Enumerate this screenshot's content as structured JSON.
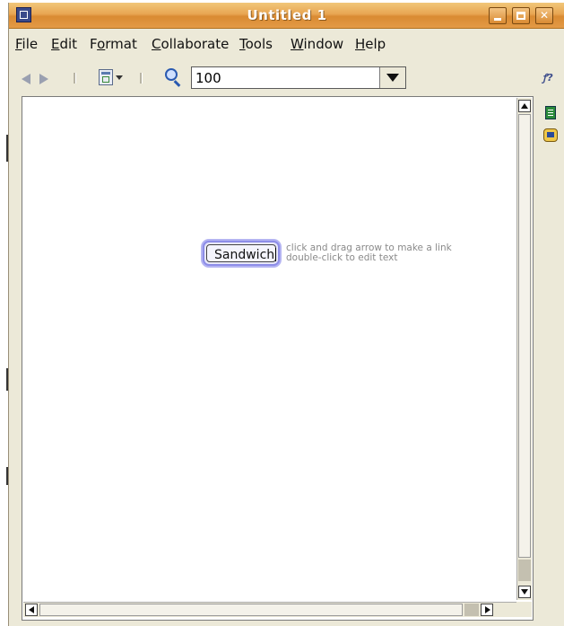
{
  "window": {
    "title": "Untitled 1"
  },
  "menu": [
    {
      "pre": "",
      "u": "F",
      "post": "ile"
    },
    {
      "pre": "",
      "u": "E",
      "post": "dit"
    },
    {
      "pre": "F",
      "u": "o",
      "post": "rmat"
    },
    {
      "pre": "",
      "u": "C",
      "post": "ollaborate"
    },
    {
      "pre": "",
      "u": "T",
      "post": "ools"
    },
    {
      "pre": "",
      "u": "W",
      "post": "indow"
    },
    {
      "pre": "",
      "u": "H",
      "post": "elp"
    }
  ],
  "toolbar": {
    "zoom_value": "100"
  },
  "canvas": {
    "node_label": "Sandwich",
    "hint_line1": "click and drag arrow to make a link",
    "hint_line2": "double-click to edit text"
  },
  "icons": {
    "app": "app-icon",
    "back": "back-arrow-icon",
    "forward": "forward-arrow-icon",
    "view": "view-mode-icon",
    "zoom": "zoom-icon",
    "help": "context-help-icon",
    "notes": "notes-icon",
    "collaborators": "collaborators-icon"
  }
}
